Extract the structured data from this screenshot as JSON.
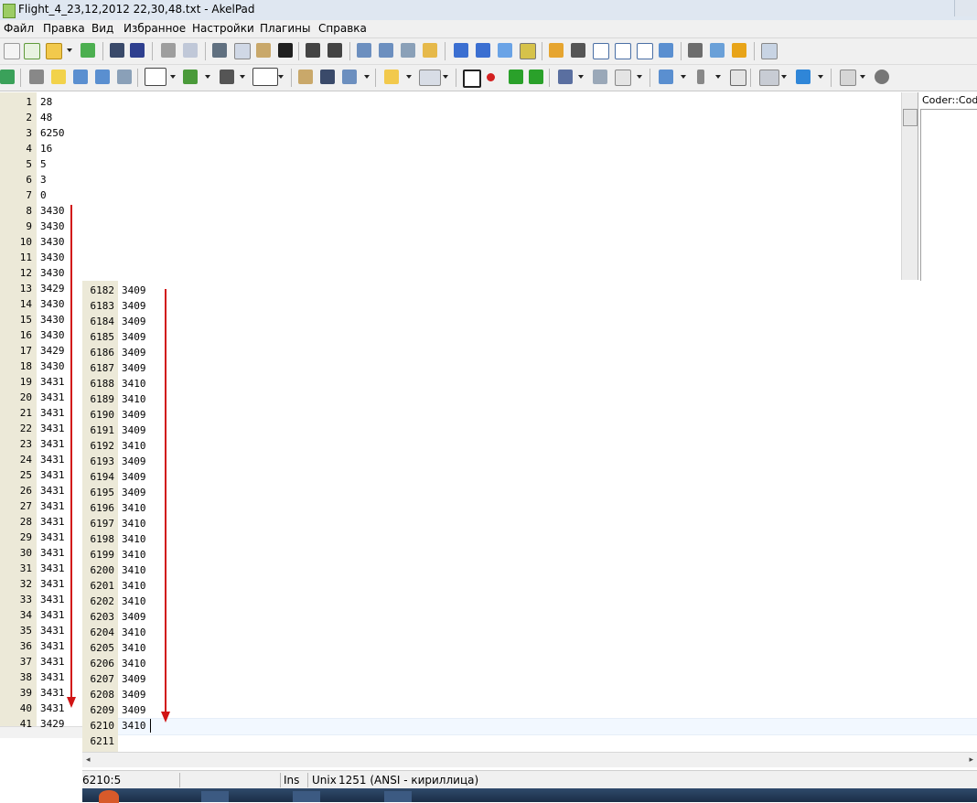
{
  "window": {
    "title": "Flight_4_23,12,2012 22,30,48.txt - AkelPad"
  },
  "menu": [
    "Файл",
    "Правка",
    "Вид",
    "Избранное",
    "Настройки",
    "Плагины",
    "Справка"
  ],
  "editor_top": {
    "line_numbers": [
      "1",
      "2",
      "3",
      "4",
      "5",
      "6",
      "7",
      "8",
      "9",
      "10",
      "11",
      "12",
      "13",
      "14",
      "15",
      "16",
      "17",
      "18",
      "19",
      "20",
      "21",
      "22",
      "23",
      "24",
      "25",
      "26",
      "27",
      "28",
      "29",
      "30",
      "31",
      "32",
      "33",
      "34",
      "35",
      "36",
      "37",
      "38",
      "39",
      "40",
      "41"
    ],
    "lines": [
      "28",
      "48",
      "6250",
      "16",
      "5",
      "3",
      "0",
      "3430",
      "3430",
      "3430",
      "3430",
      "3430",
      "3429",
      "3430",
      "3430",
      "3430",
      "3429",
      "3430",
      "3431",
      "3431",
      "3431",
      "3431",
      "3431",
      "3431",
      "3431",
      "3431",
      "3431",
      "3431",
      "3431",
      "3431",
      "3431",
      "3431",
      "3431",
      "3431",
      "3431",
      "3431",
      "3431",
      "3431",
      "3431",
      "3431",
      "3429"
    ]
  },
  "side_panel": {
    "title": "Coder::CodeF"
  },
  "editor_bottom": {
    "line_numbers": [
      "6182",
      "6183",
      "6184",
      "6185",
      "6186",
      "6187",
      "6188",
      "6189",
      "6190",
      "6191",
      "6192",
      "6193",
      "6194",
      "6195",
      "6196",
      "6197",
      "6198",
      "6199",
      "6200",
      "6201",
      "6202",
      "6203",
      "6204",
      "6205",
      "6206",
      "6207",
      "6208",
      "6209",
      "6210",
      "6211"
    ],
    "lines": [
      "3409",
      "3409",
      "3409",
      "3409",
      "3409",
      "3409",
      "3410",
      "3410",
      "3409",
      "3409",
      "3410",
      "3409",
      "3409",
      "3409",
      "3410",
      "3410",
      "3410",
      "3410",
      "3410",
      "3410",
      "3410",
      "3409",
      "3410",
      "3410",
      "3410",
      "3409",
      "3409",
      "3409",
      "3410",
      ""
    ]
  },
  "status": {
    "position": "6210:5",
    "mode": "Ins",
    "newline": "Unix",
    "encoding": "1251  (ANSI - кириллица)"
  },
  "colors": {
    "arrow": "#d11414",
    "gutter": "#ece9d8"
  }
}
